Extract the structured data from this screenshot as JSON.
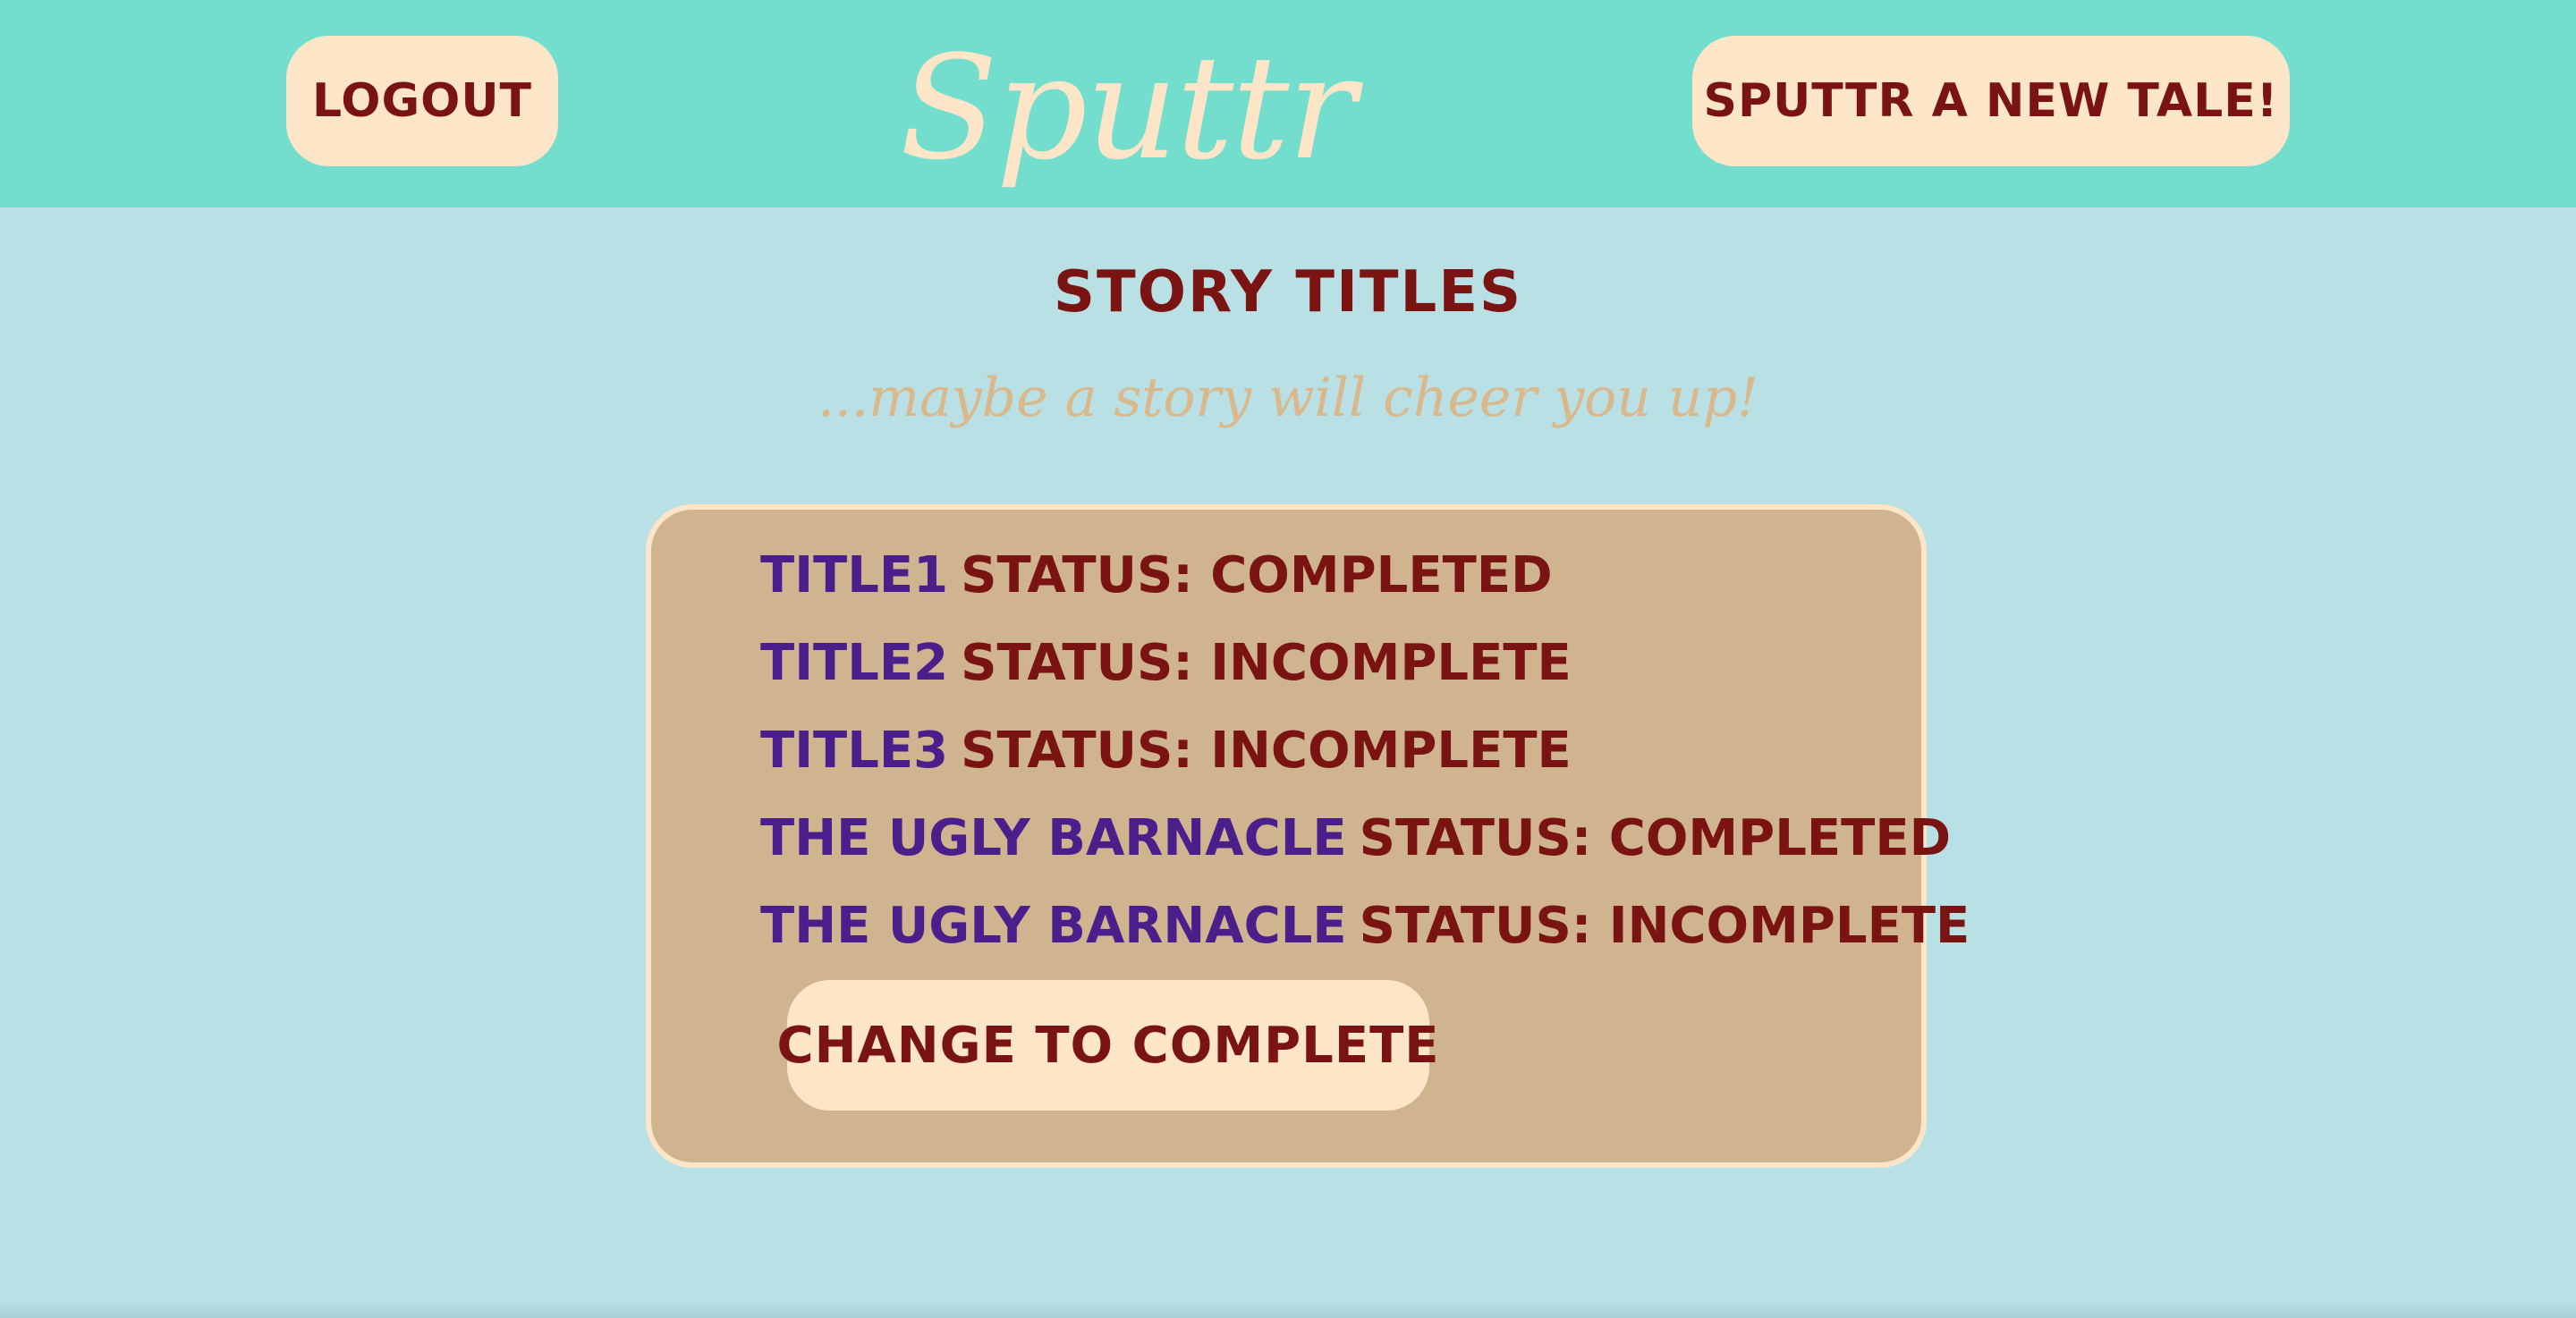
{
  "header": {
    "logout_label": "Logout",
    "logo_text": "Sputtr",
    "new_tale_label": "Sputtr a new tale!"
  },
  "main": {
    "title": "Story Titles",
    "subtitle": "...maybe a story will cheer you up!",
    "stories": [
      {
        "title": "Title1",
        "status": "Status: Completed"
      },
      {
        "title": "Title2",
        "status": "Status: Incomplete"
      },
      {
        "title": "Title3",
        "status": "Status: Incomplete"
      },
      {
        "title": "The Ugly Barnacle",
        "status": "Status: Completed"
      },
      {
        "title": "The Ugly Barnacle",
        "status": "Status: Incomplete"
      }
    ],
    "change_button_label": "Change to Complete"
  },
  "colors": {
    "header_bg": "#74dece",
    "page_bg": "#b9e0e4",
    "button_bg": "#fde6c8",
    "text_dark_red": "#7a1412",
    "title_purple": "#4a1f8c",
    "panel_bg": "#cfb48f",
    "subtitle_tan": "#d9b88c"
  }
}
